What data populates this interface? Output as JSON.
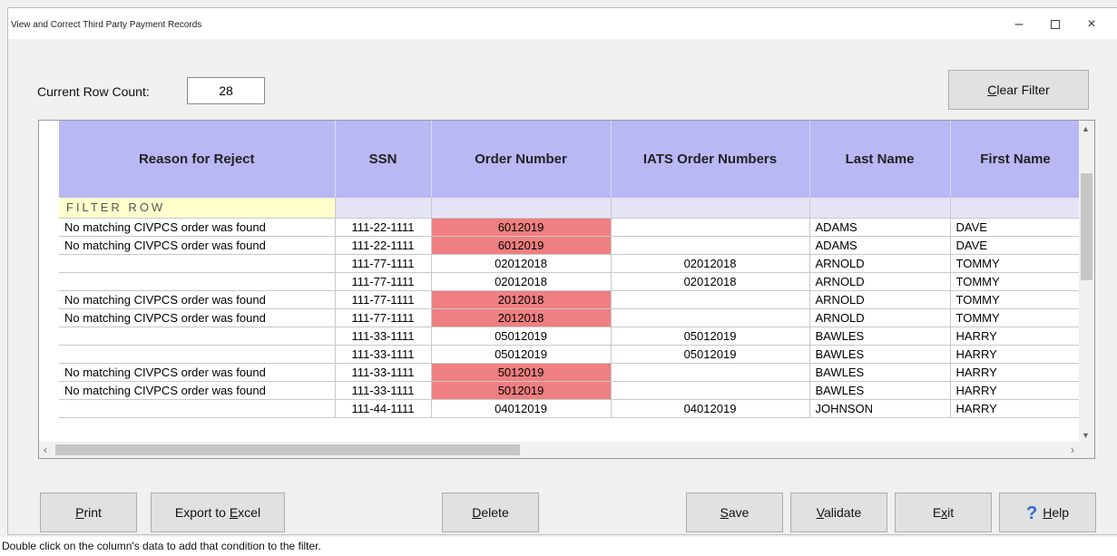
{
  "window": {
    "title": "View and Correct Third Party Payment Records",
    "minimize": "–",
    "close": "×"
  },
  "rowcount": {
    "label": "Current Row Count:",
    "value": "28"
  },
  "buttons": {
    "clear_filter_pre": "",
    "clear_filter_ul": "C",
    "clear_filter_post": "lear Filter",
    "print_ul": "P",
    "print_post": "rint",
    "export_pre": "Export to ",
    "export_ul": "E",
    "export_post": "xcel",
    "delete_ul": "D",
    "delete_post": "elete",
    "save_ul": "S",
    "save_post": "ave",
    "validate_ul": "V",
    "validate_post": "alidate",
    "exit_pre": "E",
    "exit_ul": "x",
    "exit_post": "it",
    "help_ul": "H",
    "help_post": "elp",
    "help_icon": "?"
  },
  "grid": {
    "headers": [
      "Reason for Reject",
      "SSN",
      "Order Number",
      "IATS Order Numbers",
      "Last Name",
      "First Name"
    ],
    "filter_label": "FILTER ROW",
    "rows": [
      {
        "reason": "No matching CIVPCS order was found",
        "ssn": "111-22-1111",
        "order": "6012019",
        "iats": "",
        "last": "ADAMS",
        "first": "DAVE",
        "bad": true
      },
      {
        "reason": "No matching CIVPCS order was found",
        "ssn": "111-22-1111",
        "order": "6012019",
        "iats": "",
        "last": "ADAMS",
        "first": "DAVE",
        "bad": true
      },
      {
        "reason": "",
        "ssn": "111-77-1111",
        "order": "02012018",
        "iats": "02012018",
        "last": "ARNOLD",
        "first": "TOMMY",
        "bad": false
      },
      {
        "reason": "",
        "ssn": "111-77-1111",
        "order": "02012018",
        "iats": "02012018",
        "last": "ARNOLD",
        "first": "TOMMY",
        "bad": false
      },
      {
        "reason": "No matching CIVPCS order was found",
        "ssn": "111-77-1111",
        "order": "2012018",
        "iats": "",
        "last": "ARNOLD",
        "first": "TOMMY",
        "bad": true
      },
      {
        "reason": "No matching CIVPCS order was found",
        "ssn": "111-77-1111",
        "order": "2012018",
        "iats": "",
        "last": "ARNOLD",
        "first": "TOMMY",
        "bad": true
      },
      {
        "reason": "",
        "ssn": "111-33-1111",
        "order": "05012019",
        "iats": "05012019",
        "last": "BAWLES",
        "first": "HARRY",
        "bad": false
      },
      {
        "reason": "",
        "ssn": "111-33-1111",
        "order": "05012019",
        "iats": "05012019",
        "last": "BAWLES",
        "first": "HARRY",
        "bad": false
      },
      {
        "reason": "No matching CIVPCS order was found",
        "ssn": "111-33-1111",
        "order": "5012019",
        "iats": "",
        "last": "BAWLES",
        "first": "HARRY",
        "bad": true
      },
      {
        "reason": "No matching CIVPCS order was found",
        "ssn": "111-33-1111",
        "order": "5012019",
        "iats": "",
        "last": "BAWLES",
        "first": "HARRY",
        "bad": true
      },
      {
        "reason": "",
        "ssn": "111-44-1111",
        "order": "04012019",
        "iats": "04012019",
        "last": "JOHNSON",
        "first": "HARRY",
        "bad": false
      }
    ],
    "highlight_color": "#ef7f80",
    "header_color": "#b8b8f4"
  },
  "statusbar": {
    "text": "Double click on the column's data to add that condition to the filter."
  }
}
